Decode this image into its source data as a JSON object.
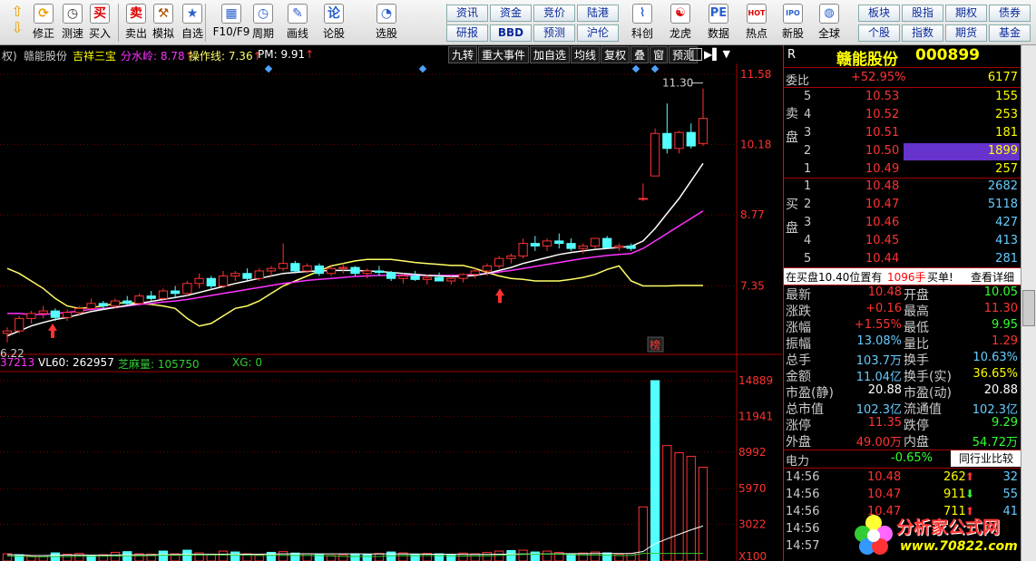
{
  "toolbar": {
    "buttons": [
      {
        "label": "修正",
        "icon": "up-down-icon"
      },
      {
        "label": "测速",
        "icon": "clock-icon"
      },
      {
        "label": "买入",
        "icon": "buy-icon"
      },
      {
        "label": "卖出",
        "icon": "sell-icon"
      },
      {
        "label": "模拟",
        "icon": "gavel-icon"
      },
      {
        "label": "自选",
        "icon": "star-icon"
      },
      {
        "label": "F10/F9",
        "icon": "f10-icon"
      },
      {
        "label": "周期",
        "icon": "cycle-icon"
      },
      {
        "label": "画线",
        "icon": "pen-icon"
      },
      {
        "label": "论股",
        "icon": "discuss-icon"
      },
      {
        "label": "选股",
        "icon": "select-stock-icon"
      }
    ],
    "text_buttons_row1": [
      "资讯",
      "资金",
      "竞价",
      "陆港"
    ],
    "text_buttons_row2": [
      "研报",
      "BBD",
      "预测",
      "沪伦"
    ],
    "buttons2": [
      {
        "label": "科创",
        "icon": "star-board-icon"
      },
      {
        "label": "龙虎",
        "icon": "dragon-tiger-icon"
      },
      {
        "label": "数据",
        "icon": "data-icon"
      },
      {
        "label": "热点",
        "icon": "hot-icon"
      },
      {
        "label": "新股",
        "icon": "new-stock-icon"
      },
      {
        "label": "全球",
        "icon": "globe-icon"
      }
    ],
    "right_row1": [
      "板块",
      "股指",
      "期权",
      "债券"
    ],
    "right_row2": [
      "个股",
      "指数",
      "期货",
      "基金"
    ]
  },
  "info_bar": {
    "prefix": "权)",
    "name": "赣能股份",
    "ind1": "吉祥三宝",
    "ind2": "分水岭: 8.78",
    "ind3": "操作线: 7.36",
    "ind4": "PM: 9.91",
    "colors": {
      "name": "#cccccc",
      "ind1": "#ffff00",
      "ind2": "#ff33ff",
      "ind3": "#ffff66",
      "ind4": "#ffffff"
    }
  },
  "chart_tools": [
    "九转",
    "重大事件",
    "加自选",
    "均线",
    "复权",
    "叠",
    "窗",
    "预测"
  ],
  "price_axis": {
    "labels": [
      "11.58",
      "10.18",
      "8.77",
      "7.35"
    ],
    "high_label": "11.30",
    "low_label": "6.22",
    "bang": "榜"
  },
  "volume_info": {
    "v1": "37213",
    "v2": "VL60: 262957",
    "v3": "芝麻量: 105750",
    "v4": "XG: 0"
  },
  "volume_axis": {
    "labels": [
      "14889",
      "11941",
      "8992",
      "5970",
      "3022",
      "X100"
    ]
  },
  "chart_data": {
    "type": "candlestick",
    "candles": [
      [
        6.4,
        6.52,
        6.22,
        6.45
      ],
      [
        6.45,
        6.75,
        6.4,
        6.7
      ],
      [
        6.7,
        6.85,
        6.6,
        6.8
      ],
      [
        6.8,
        6.95,
        6.7,
        6.85
      ],
      [
        6.85,
        6.9,
        6.65,
        6.72
      ],
      [
        6.72,
        6.88,
        6.65,
        6.82
      ],
      [
        6.82,
        6.95,
        6.75,
        6.9
      ],
      [
        6.9,
        7.1,
        6.85,
        7.0
      ],
      [
        7.0,
        7.05,
        6.88,
        6.95
      ],
      [
        6.95,
        7.1,
        6.9,
        7.05
      ],
      [
        7.05,
        7.15,
        6.98,
        7.0
      ],
      [
        7.0,
        7.2,
        6.95,
        7.15
      ],
      [
        7.15,
        7.25,
        7.05,
        7.1
      ],
      [
        7.1,
        7.3,
        7.05,
        7.25
      ],
      [
        7.25,
        7.35,
        7.1,
        7.2
      ],
      [
        7.2,
        7.45,
        7.15,
        7.4
      ],
      [
        7.4,
        7.6,
        7.3,
        7.5
      ],
      [
        7.5,
        7.55,
        7.3,
        7.35
      ],
      [
        7.35,
        7.65,
        7.3,
        7.55
      ],
      [
        7.55,
        7.65,
        7.45,
        7.6
      ],
      [
        7.6,
        7.7,
        7.45,
        7.5
      ],
      [
        7.5,
        7.7,
        7.45,
        7.65
      ],
      [
        7.65,
        7.75,
        7.55,
        7.7
      ],
      [
        7.7,
        8.2,
        7.65,
        7.8
      ],
      [
        7.8,
        7.85,
        7.6,
        7.65
      ],
      [
        7.65,
        7.8,
        7.6,
        7.75
      ],
      [
        7.75,
        7.8,
        7.55,
        7.6
      ],
      [
        7.6,
        7.75,
        7.55,
        7.7
      ],
      [
        7.7,
        7.8,
        7.6,
        7.72
      ],
      [
        7.72,
        7.75,
        7.55,
        7.6
      ],
      [
        7.6,
        7.7,
        7.5,
        7.65
      ],
      [
        7.65,
        7.75,
        7.55,
        7.62
      ],
      [
        7.62,
        7.65,
        7.45,
        7.5
      ],
      [
        7.5,
        7.6,
        7.4,
        7.55
      ],
      [
        7.55,
        7.65,
        7.45,
        7.48
      ],
      [
        7.48,
        7.58,
        7.38,
        7.52
      ],
      [
        7.52,
        7.62,
        7.45,
        7.45
      ],
      [
        7.45,
        7.55,
        7.38,
        7.5
      ],
      [
        7.5,
        7.6,
        7.42,
        7.58
      ],
      [
        7.58,
        7.7,
        7.5,
        7.65
      ],
      [
        7.65,
        7.8,
        7.55,
        7.75
      ],
      [
        7.75,
        7.95,
        7.7,
        7.9
      ],
      [
        7.9,
        8.0,
        7.8,
        7.95
      ],
      [
        7.95,
        8.3,
        7.9,
        8.2
      ],
      [
        8.2,
        8.35,
        8.05,
        8.15
      ],
      [
        8.15,
        8.3,
        8.05,
        8.25
      ],
      [
        8.25,
        8.4,
        8.1,
        8.2
      ],
      [
        8.2,
        8.3,
        8.05,
        8.1
      ],
      [
        8.1,
        8.2,
        8.0,
        8.15
      ],
      [
        8.15,
        8.3,
        8.1,
        8.3
      ],
      [
        8.3,
        8.35,
        8.1,
        8.12
      ],
      [
        8.12,
        8.2,
        8.05,
        8.15
      ],
      [
        8.15,
        8.2,
        8.05,
        8.1
      ],
      [
        9.1,
        9.4,
        9.05,
        9.1
      ],
      [
        9.55,
        10.5,
        9.55,
        10.4
      ],
      [
        10.4,
        11.0,
        10.0,
        10.1
      ],
      [
        10.1,
        10.45,
        10.0,
        10.42
      ],
      [
        10.42,
        10.6,
        10.1,
        10.15
      ],
      [
        10.2,
        11.3,
        10.15,
        10.7
      ]
    ],
    "volumes": [
      [
        40,
        1
      ],
      [
        35,
        0
      ],
      [
        28,
        1
      ],
      [
        30,
        1
      ],
      [
        45,
        0
      ],
      [
        38,
        1
      ],
      [
        42,
        1
      ],
      [
        30,
        0
      ],
      [
        35,
        1
      ],
      [
        48,
        1
      ],
      [
        52,
        0
      ],
      [
        40,
        1
      ],
      [
        38,
        1
      ],
      [
        55,
        0
      ],
      [
        40,
        1
      ],
      [
        60,
        0
      ],
      [
        45,
        1
      ],
      [
        38,
        1
      ],
      [
        55,
        1
      ],
      [
        50,
        0
      ],
      [
        40,
        1
      ],
      [
        35,
        1
      ],
      [
        48,
        0
      ],
      [
        52,
        1
      ],
      [
        44,
        0
      ],
      [
        40,
        1
      ],
      [
        36,
        0
      ],
      [
        30,
        1
      ],
      [
        35,
        1
      ],
      [
        40,
        0
      ],
      [
        38,
        0
      ],
      [
        42,
        1
      ],
      [
        50,
        0
      ],
      [
        45,
        1
      ],
      [
        38,
        0
      ],
      [
        42,
        1
      ],
      [
        40,
        0
      ],
      [
        35,
        0
      ],
      [
        44,
        1
      ],
      [
        40,
        1
      ],
      [
        48,
        1
      ],
      [
        55,
        1
      ],
      [
        58,
        0
      ],
      [
        60,
        1
      ],
      [
        50,
        0
      ],
      [
        55,
        1
      ],
      [
        48,
        1
      ],
      [
        40,
        0
      ],
      [
        44,
        1
      ],
      [
        50,
        1
      ],
      [
        45,
        0
      ],
      [
        38,
        1
      ],
      [
        42,
        1
      ],
      [
        300,
        1
      ],
      [
        1000,
        0
      ],
      [
        640,
        1
      ],
      [
        600,
        1
      ],
      [
        580,
        1
      ],
      [
        520,
        1
      ]
    ],
    "ma_white": [
      6.35,
      6.45,
      6.55,
      6.62,
      6.68,
      6.72,
      6.78,
      6.84,
      6.88,
      6.92,
      6.96,
      7.0,
      7.04,
      7.08,
      7.12,
      7.16,
      7.22,
      7.28,
      7.34,
      7.4,
      7.45,
      7.5,
      7.55,
      7.6,
      7.62,
      7.64,
      7.65,
      7.66,
      7.66,
      7.66,
      7.65,
      7.64,
      7.62,
      7.6,
      7.58,
      7.56,
      7.55,
      7.54,
      7.54,
      7.56,
      7.6,
      7.66,
      7.72,
      7.8,
      7.86,
      7.92,
      7.98,
      8.02,
      8.05,
      8.08,
      8.1,
      8.12,
      8.14,
      8.25,
      8.5,
      8.8,
      9.1,
      9.45,
      9.8
    ],
    "ma_magenta": [
      6.8,
      6.8,
      6.78,
      6.78,
      6.8,
      6.82,
      6.85,
      6.88,
      6.9,
      6.92,
      6.95,
      6.98,
      7.0,
      7.03,
      7.05,
      7.08,
      7.12,
      7.16,
      7.2,
      7.24,
      7.28,
      7.32,
      7.36,
      7.4,
      7.43,
      7.46,
      7.48,
      7.5,
      7.52,
      7.54,
      7.55,
      7.56,
      7.56,
      7.56,
      7.56,
      7.56,
      7.56,
      7.56,
      7.57,
      7.58,
      7.6,
      7.63,
      7.66,
      7.7,
      7.74,
      7.78,
      7.82,
      7.86,
      7.9,
      7.93,
      7.96,
      7.98,
      8.0,
      8.1,
      8.25,
      8.4,
      8.55,
      8.7,
      8.85
    ],
    "ma_yellow": [
      7.7,
      7.6,
      7.45,
      7.3,
      7.1,
      6.95,
      6.9,
      6.92,
      6.95,
      7.0,
      7.02,
      7.0,
      6.98,
      6.95,
      6.9,
      6.7,
      6.55,
      6.6,
      6.75,
      6.9,
      6.95,
      7.05,
      7.2,
      7.35,
      7.45,
      7.55,
      7.65,
      7.75,
      7.8,
      7.85,
      7.88,
      7.88,
      7.88,
      7.85,
      7.82,
      7.8,
      7.78,
      7.76,
      7.76,
      7.7,
      7.62,
      7.55,
      7.5,
      7.48,
      7.45,
      7.45,
      7.45,
      7.48,
      7.52,
      7.58,
      7.68,
      7.75,
      7.45,
      7.35,
      7.35,
      7.35,
      7.36,
      7.36,
      7.36
    ],
    "price_range": [
      6.0,
      11.8
    ]
  },
  "right": {
    "stock_name": "赣能股份",
    "stock_code": "000899",
    "r_label": "R",
    "weibi": {
      "label": "委比",
      "value": "+52.95%",
      "vol": "6177"
    },
    "sell_label": "卖盘",
    "buy_label": "买盘",
    "asks": [
      {
        "lv": "5",
        "price": "10.53",
        "vol": "155"
      },
      {
        "lv": "4",
        "price": "10.52",
        "vol": "253"
      },
      {
        "lv": "3",
        "price": "10.51",
        "vol": "181"
      },
      {
        "lv": "2",
        "price": "10.50",
        "vol": "1899"
      },
      {
        "lv": "1",
        "price": "10.49",
        "vol": "257"
      }
    ],
    "bids": [
      {
        "lv": "1",
        "price": "10.48",
        "vol": "2682"
      },
      {
        "lv": "2",
        "price": "10.47",
        "vol": "5118"
      },
      {
        "lv": "3",
        "price": "10.46",
        "vol": "427"
      },
      {
        "lv": "4",
        "price": "10.45",
        "vol": "413"
      },
      {
        "lv": "5",
        "price": "10.44",
        "vol": "281"
      }
    ],
    "notice": {
      "text": "在买盘10.40位置有",
      "vol": "1096手",
      "tag": "买单!",
      "link": "查看详细"
    },
    "quote": [
      {
        "l1": "最新",
        "v1": "10.48",
        "l2": "开盘",
        "v2": "10.05"
      },
      {
        "l1": "涨跌",
        "v1": "+0.16",
        "l2": "最高",
        "v2": "11.30"
      },
      {
        "l1": "涨幅",
        "v1": "+1.55%",
        "l2": "最低",
        "v2": "9.95"
      },
      {
        "l1": "振幅",
        "v1": "13.08%",
        "l2": "量比",
        "v2": "1.29"
      },
      {
        "l1": "总手",
        "v1": "103.7万",
        "l2": "换手",
        "v2": "10.63%"
      },
      {
        "l1": "金额",
        "v1": "11.04亿",
        "l2": "换手(实)",
        "v2": "36.65%"
      },
      {
        "l1": "市盈(静)",
        "v1": "20.88",
        "l2": "市盈(动)",
        "v2": "20.88"
      },
      {
        "l1": "总市值",
        "v1": "102.3亿",
        "l2": "流通值",
        "v2": "102.3亿"
      },
      {
        "l1": "涨停",
        "v1": "11.35",
        "l2": "跌停",
        "v2": "9.29"
      },
      {
        "l1": "外盘",
        "v1": "49.00万",
        "l2": "内盘",
        "v2": "54.72万"
      }
    ],
    "industry": {
      "name": "电力",
      "change": "-0.65%",
      "btn": "同行业比较"
    },
    "ticks": [
      {
        "t": "14:56",
        "p": "10.48",
        "v": "262",
        "n": "32"
      },
      {
        "t": "14:56",
        "p": "10.47",
        "v": "911",
        "n": "55"
      },
      {
        "t": "14:56",
        "p": "10.47",
        "v": "711",
        "n": "41"
      },
      {
        "t": "14:56",
        "p": "",
        "v": "",
        "n": ""
      },
      {
        "t": "14:57",
        "p": "",
        "v": "",
        "n": ""
      }
    ]
  },
  "logo": {
    "title": "分析家公式网",
    "url": "www.70822.com"
  }
}
